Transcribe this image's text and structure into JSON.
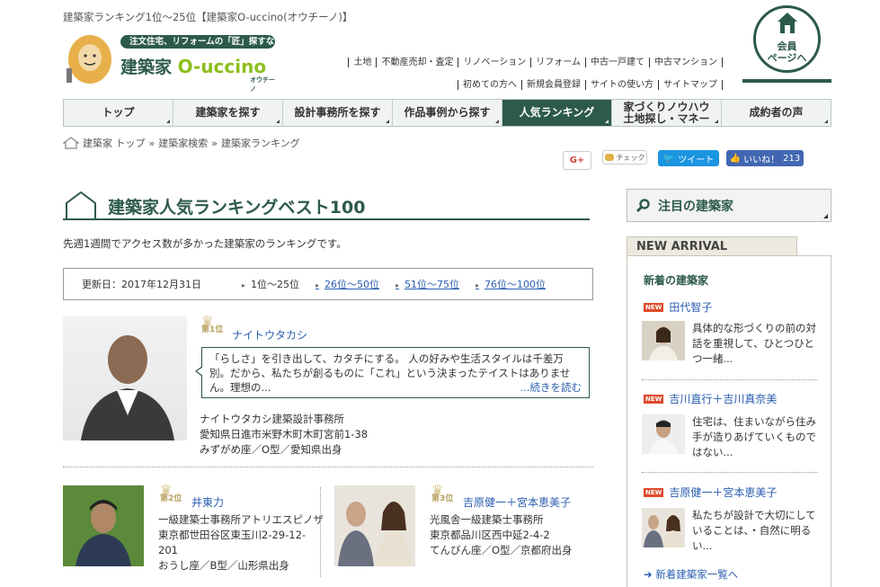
{
  "header": {
    "caption": "建築家ランキング1位〜25位【建築家O-uccino(オウチーノ)】",
    "logo": {
      "slogan": "注文住宅、リフォームの「匠」探すなら",
      "name_prefix": "建築家",
      "name_brand": "O-uccino",
      "kana": "オウチーノ"
    },
    "links_row1": [
      "土地",
      "不動産売却・査定",
      "リノベーション",
      "リフォーム",
      "中古一戸建て",
      "中古マンション"
    ],
    "links_row2": [
      "初めての方へ",
      "新規会員登録",
      "サイトの使い方",
      "サイトマップ"
    ],
    "member": {
      "line1": "会員",
      "line2": "ページへ"
    }
  },
  "nav": {
    "items": [
      {
        "label": "トップ"
      },
      {
        "label": "建築家を探す"
      },
      {
        "label": "設計事務所を探す"
      },
      {
        "label": "作品事例から探す"
      },
      {
        "label": "人気ランキング"
      },
      {
        "label": "家づくりノウハウ\n土地探し・マネー"
      },
      {
        "label": "成約者の声"
      }
    ],
    "active_index": 4
  },
  "breadcrumb": {
    "items": [
      "建築家 トップ",
      "建築家検索",
      "建築家ランキング"
    ],
    "separator": "»"
  },
  "share": {
    "google": "G+",
    "check": "チェック",
    "tweet": "ツイート",
    "like": "いいね！",
    "like_count": "213"
  },
  "main": {
    "title": "建築家人気ランキングベスト100",
    "lead": "先週1週間でアクセス数が多かった建築家のランキングです。",
    "updated": "更新日：2017年12月31日",
    "ranges": [
      {
        "label": "1位〜25位",
        "link": false
      },
      {
        "label": "26位〜50位",
        "link": true
      },
      {
        "label": "51位〜75位",
        "link": true
      },
      {
        "label": "76位〜100位",
        "link": true
      }
    ],
    "rank1": {
      "rank": "第1位",
      "name": "ナイトウタカシ",
      "comment": "「らしさ」を引き出して、カタチにする。 人の好みや生活スタイルは千差万別。だから、私たちが創るものに「これ」という決まったテイストはありません。理想の...",
      "readmore": "...続きを読む",
      "office": "ナイトウタカシ建築設計事務所",
      "address": "愛知県日進市米野木町木町宮前1-38",
      "profile": "みずがめ座／O型／愛知県出身"
    },
    "rank2": {
      "rank": "第2位",
      "name": "井東力",
      "office": "一級建築士事務所アトリエスピノザ",
      "address1": "東京都世田谷区東玉川2-29-12-",
      "address2": "201",
      "profile": "おうし座／B型／山形県出身"
    },
    "rank3": {
      "rank": "第3位",
      "name": "吉原健一＋宮本恵美子",
      "office": "光風舎一級建築士事務所",
      "address": "東京都品川区西中延2-4-2",
      "profile": "てんびん座／O型／京都府出身"
    }
  },
  "sidebar": {
    "heading": "注目の建築家",
    "tab": "NEW ARRIVAL",
    "box_title": "新着の建築家",
    "badge": "NEW",
    "items": [
      {
        "name": "田代智子",
        "text": "具体的な形づくりの前の対話を重視して、ひとつひとつ一緒..."
      },
      {
        "name": "吉川直行＋吉川真奈美",
        "text": "住宅は、住まいながら住み手が造りあげていくものではない..."
      },
      {
        "name": "吉原健一＋宮本恵美子",
        "text": "私たちが設計で大切にしていることは、・自然に明るい..."
      }
    ],
    "more": "新着建築家一覧へ"
  },
  "colors": {
    "brand": "#2d5a4b",
    "lime": "#8cbf1d",
    "link": "#2a5db0",
    "new_badge": "#e04a2c",
    "twitter": "#1b95e0",
    "facebook": "#4267b2"
  }
}
